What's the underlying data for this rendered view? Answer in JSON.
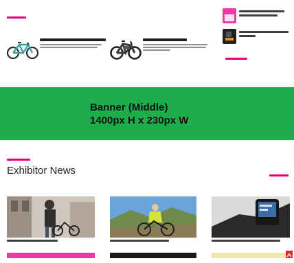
{
  "banner": {
    "line1": "Banner (Middle)",
    "line2": "1400px H x 230px W",
    "color": "#1fac4c"
  },
  "exhibitor_news": {
    "title": "Exhibitor News"
  },
  "products": [
    {
      "title": "",
      "description": ""
    },
    {
      "title": "",
      "description": ""
    }
  ],
  "sidebar_news": [
    {
      "title": ""
    },
    {
      "title": ""
    }
  ],
  "news": [
    {
      "caption": ""
    },
    {
      "caption": ""
    },
    {
      "caption": ""
    }
  ],
  "colors": {
    "accent": "#e4007c",
    "banner": "#1fac4c",
    "ad_red": "#e8242b"
  }
}
